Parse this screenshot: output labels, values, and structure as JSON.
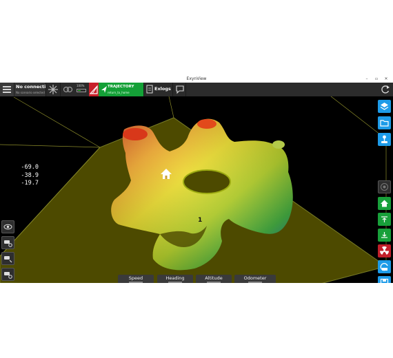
{
  "window": {
    "title": "ExynView",
    "controls": {
      "minimize": "–",
      "maximize": "▫",
      "close": "✕"
    }
  },
  "toolbar": {
    "connection": {
      "title": "No connectio",
      "subtitle": "No scenario selected"
    },
    "battery": {
      "percent": "100%",
      "level": 0.3
    },
    "trajectory": {
      "title": "TRAJECTORY",
      "subtitle": "return_to_home"
    },
    "exlogs": {
      "label": "Exlogs"
    }
  },
  "viewport": {
    "coords": [
      "-69.0",
      "-38.9",
      "-19.7"
    ],
    "waypoint_label": "1"
  },
  "gauges": [
    {
      "label": "Speed"
    },
    {
      "label": "Heading"
    },
    {
      "label": "Altitude"
    },
    {
      "label": "Odometer"
    }
  ],
  "icons": {
    "left": [
      "eye-icon",
      "robot-settings-icon",
      "robot-view-icon",
      "robot-settings-alt-icon"
    ],
    "right": [
      "layers-icon",
      "folder-icon",
      "joystick-icon",
      "camera-record-icon",
      "home-icon",
      "takeoff-icon",
      "land-icon",
      "radiation-icon",
      "return-icon",
      "save-icon"
    ]
  },
  "colors": {
    "trajectory": "#14a037",
    "alert": "#c8202a",
    "blue_action": "#1d9be8",
    "green_action": "#18a03a"
  }
}
